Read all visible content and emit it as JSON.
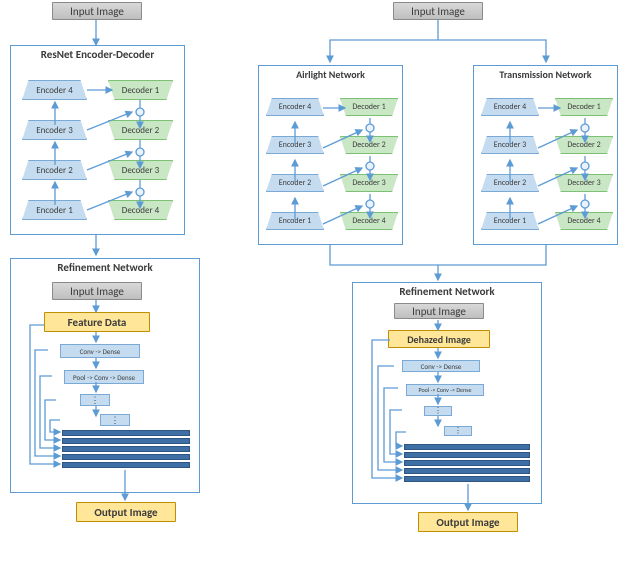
{
  "left": {
    "input_image": "Input Image",
    "encoder_box_title": "ResNet Encoder-Decoder",
    "encoders": [
      "Encoder 4",
      "Encoder 3",
      "Encoder 2",
      "Encoder 1"
    ],
    "decoders": [
      "Decoder 1",
      "Decoder 2",
      "Decoder 3",
      "Decoder 4"
    ],
    "refinement_title": "Refinement Network",
    "refinement_input": "Input Image",
    "feature_data": "Feature Data",
    "conv_dense": "Conv -> Dense",
    "pool_conv_dense": "Pool -> Conv -> Dense",
    "output_image": "Output Image"
  },
  "right": {
    "input_image": "Input Image",
    "airlight_title": "Airlight Network",
    "transmission_title": "Transmission Network",
    "encoders": [
      "Encoder 4",
      "Encoder 3",
      "Encoder 2",
      "Encoder 1"
    ],
    "decoders": [
      "Decoder 1",
      "Decoder 2",
      "Decoder 3",
      "Decoder 4"
    ],
    "refinement_title": "Refinement Network",
    "refinement_input": "Input Image",
    "dehazed_image": "Dehazed Image",
    "conv_dense": "Conv -> Dense",
    "pool_conv_dense": "Pool -> Conv -> Dense",
    "output_image": "Output Image"
  }
}
